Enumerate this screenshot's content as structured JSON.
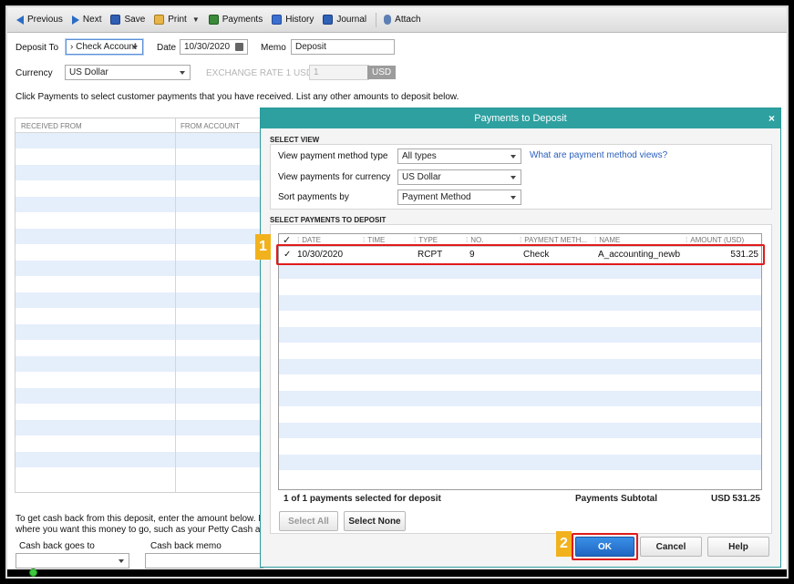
{
  "toolbar": {
    "previous": "Previous",
    "next": "Next",
    "save": "Save",
    "print": "Print",
    "payments": "Payments",
    "history": "History",
    "journal": "Journal",
    "attach": "Attach"
  },
  "form": {
    "deposit_to_label": "Deposit To",
    "deposit_to_value": "› Check Account",
    "date_label": "Date",
    "date_value": "10/30/2020",
    "memo_label": "Memo",
    "memo_value": "Deposit",
    "currency_label": "Currency",
    "currency_value": "US Dollar",
    "exchange_label": "EXCHANGE RATE 1 USD =",
    "exchange_value": "1",
    "exchange_unit": "USD",
    "instructions": "Click Payments to select customer payments that you have received. List any other amounts to deposit below."
  },
  "main_table": {
    "columns": [
      "RECEIVED FROM",
      "FROM ACCOUNT"
    ]
  },
  "cashback": {
    "note_line1": "To get cash back from this deposit, enter the amount below.  Indic",
    "note_line2": "where you want this money to go, such as your Petty Cash accour",
    "goes_to_label": "Cash back goes to",
    "memo_label": "Cash back memo"
  },
  "dialog": {
    "title": "Payments to Deposit",
    "select_view_heading": "SELECT VIEW",
    "method_type_label": "View payment method type",
    "method_type_value": "All types",
    "method_views_link": "What are payment method views?",
    "currency_label": "View payments for currency",
    "currency_value": "US Dollar",
    "sort_label": "Sort payments by",
    "sort_value": "Payment Method",
    "select_payments_heading": "SELECT PAYMENTS TO DEPOSIT",
    "columns": {
      "check": "✓",
      "date": "DATE",
      "time": "TIME",
      "type": "TYPE",
      "no": "NO.",
      "method": "PAYMENT METH...",
      "name": "NAME",
      "amount": "AMOUNT (USD)"
    },
    "rows": [
      {
        "check": "✓",
        "date": "10/30/2020",
        "time": "",
        "type": "RCPT",
        "no": "9",
        "method": "Check",
        "name": "A_accounting_newb",
        "amount": "531.25"
      }
    ],
    "selected_summary": "1 of 1 payments selected for deposit",
    "subtotal_label": "Payments Subtotal",
    "subtotal_currency": "USD",
    "subtotal_value": "531.25",
    "select_all": "Select All",
    "select_none": "Select None",
    "ok": "OK",
    "cancel": "Cancel",
    "help": "Help"
  },
  "annotations": {
    "step1": "1",
    "step2": "2"
  },
  "colors": {
    "dialog_title": "#2ea0a0",
    "highlight": "#e01b1b",
    "badge": "#f2b21d",
    "row_alt": "#e5eefb",
    "ok_button": "#1f66c2"
  }
}
